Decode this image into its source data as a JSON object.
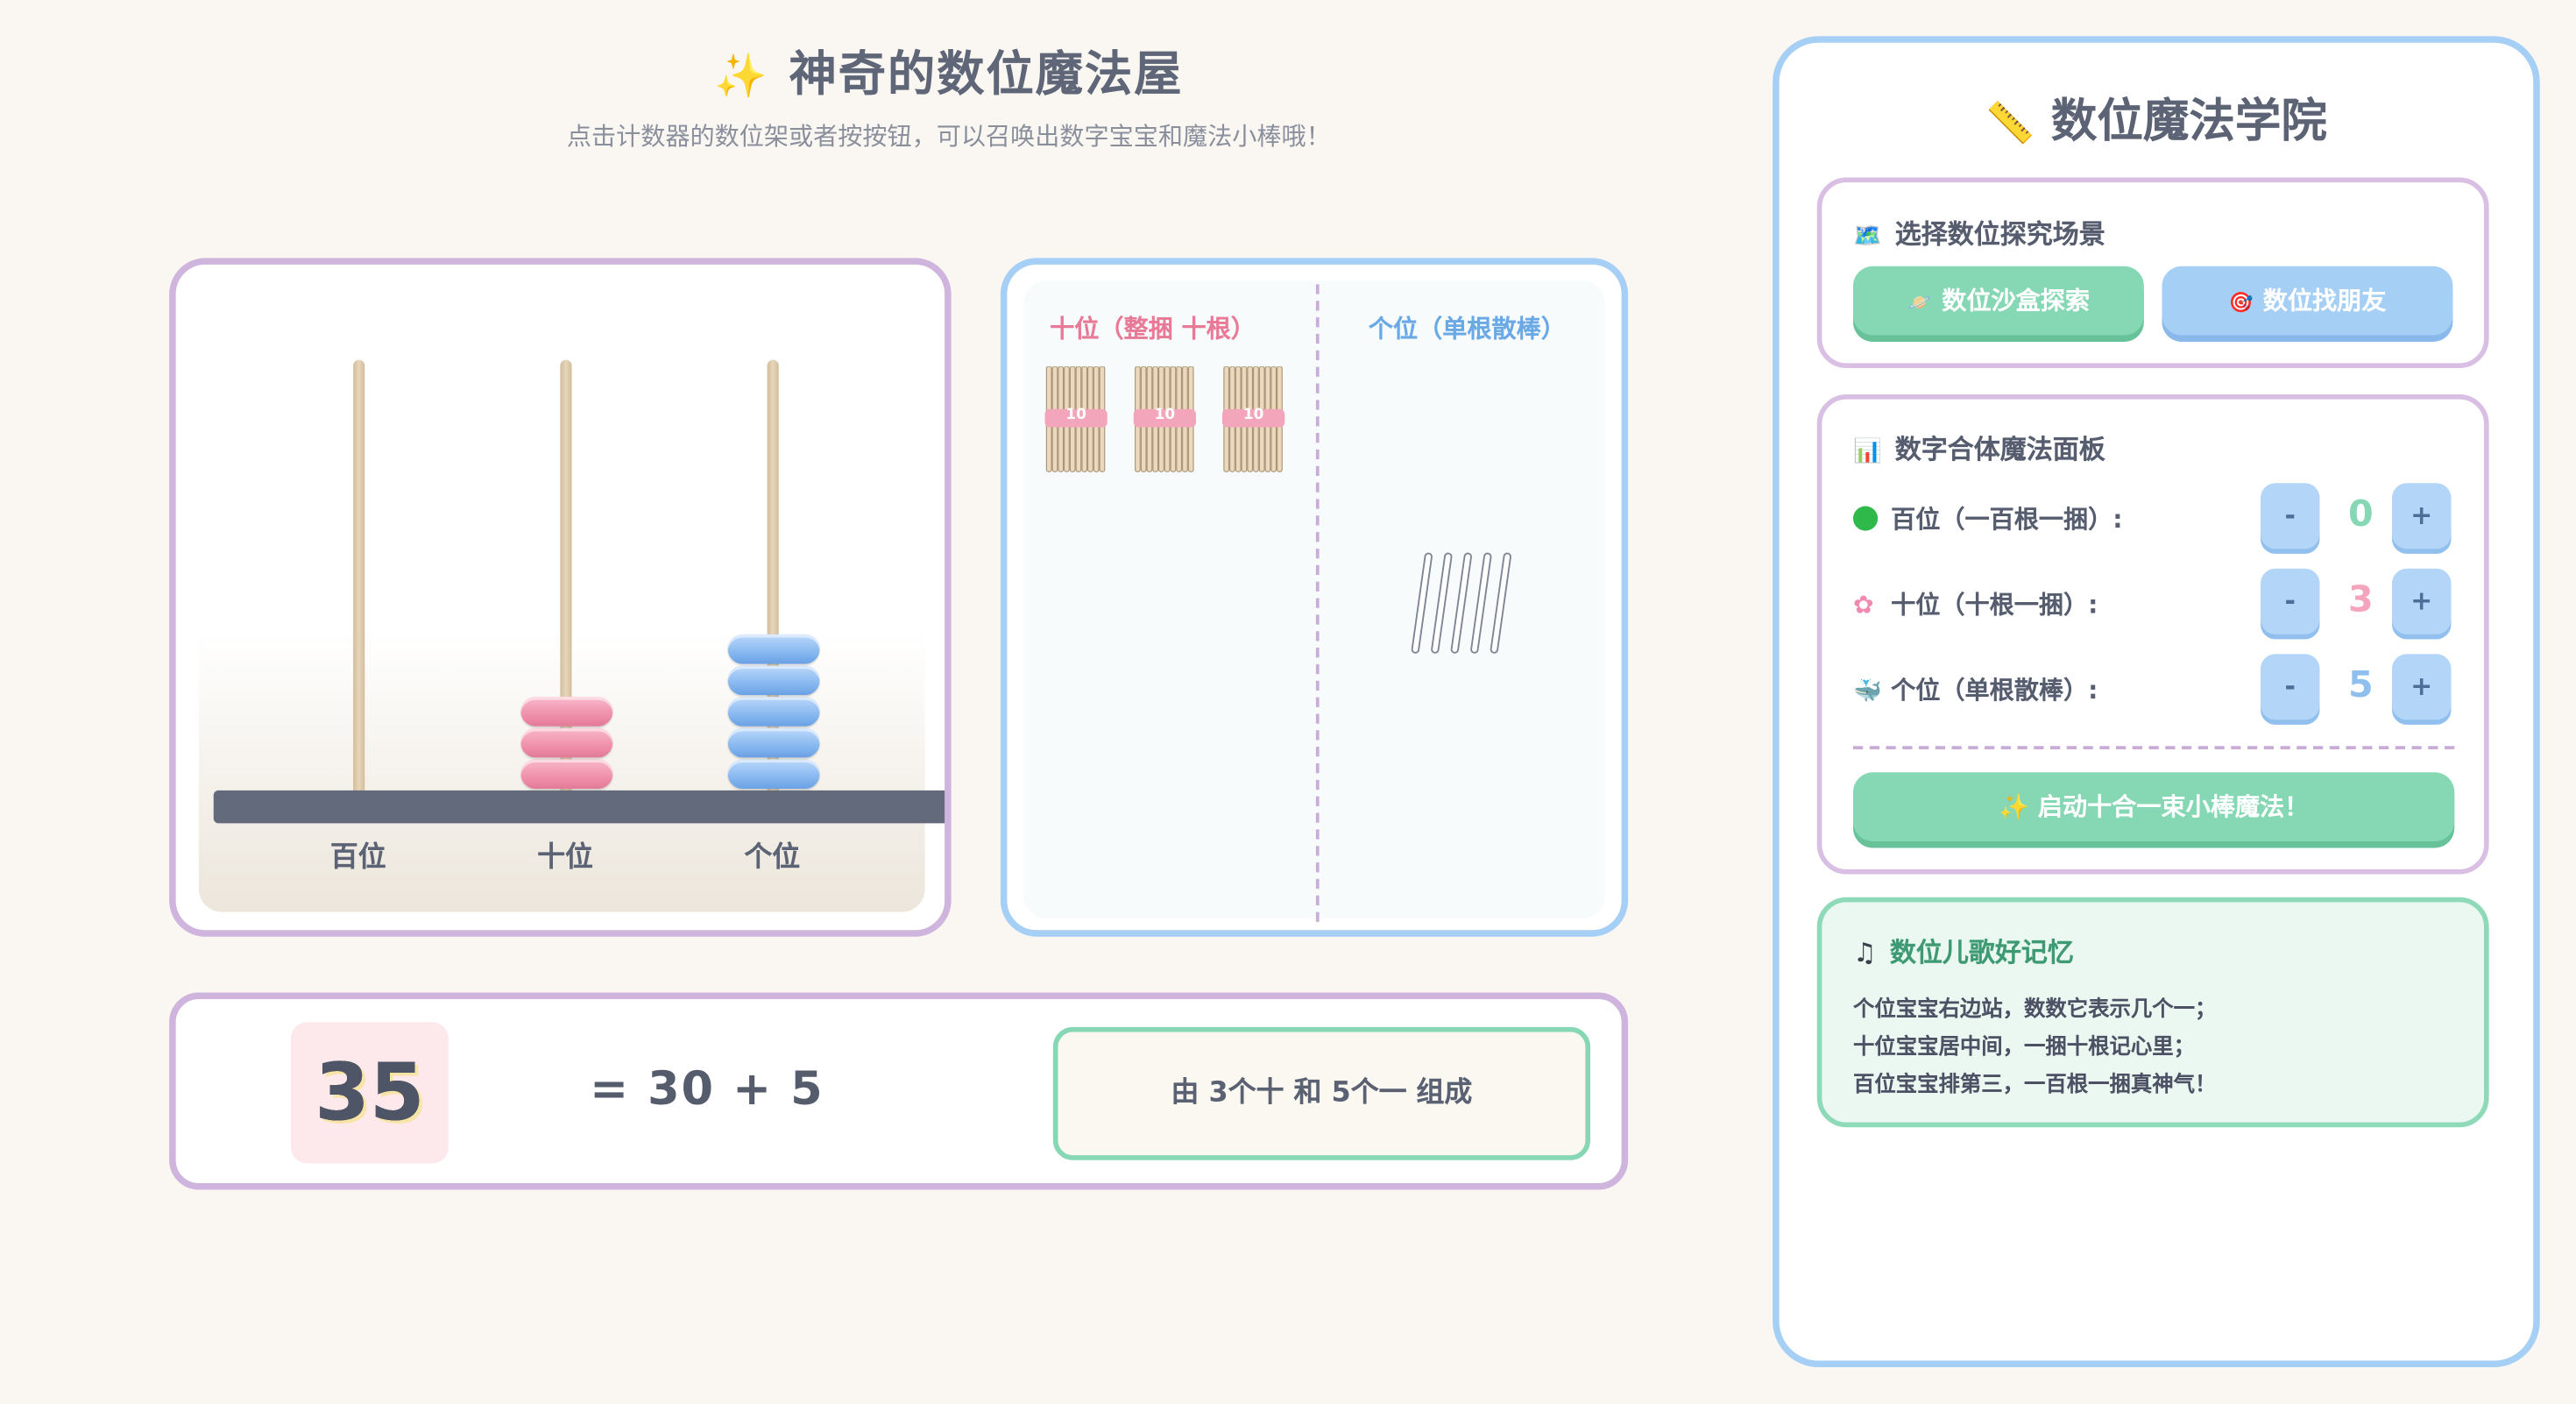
{
  "header": {
    "title": "神奇的数位魔法屋",
    "title_icon": "✨",
    "subtitle": "点击计数器的数位架或者按按钮，可以召唤出数字宝宝和魔法小棒哦！"
  },
  "abacus": {
    "rods": [
      {
        "label": "百位",
        "beads": 0,
        "color": "#ee8aa6"
      },
      {
        "label": "十位",
        "beads": 3,
        "color": "#ee8aa6"
      },
      {
        "label": "个位",
        "beads": 5,
        "color": "#80b3ee"
      }
    ]
  },
  "sticks": {
    "tens_title": "十位（整捆 十根）",
    "ones_title": "个位（单根散棒）",
    "bundle_label": "10",
    "bundle_count": 3,
    "single_count": 5
  },
  "equation": {
    "number": "35",
    "expression": "= 30 + 5",
    "composition": "由 3个十 和 5个一 组成"
  },
  "panel": {
    "title": "数位魔法学院",
    "title_icon": "📏",
    "scene": {
      "title": "选择数位探究场景",
      "icon": "🗺️",
      "buttons": [
        {
          "icon": "🪐",
          "label": "数位沙盒探索"
        },
        {
          "icon": "🎯",
          "label": "数位找朋友"
        }
      ]
    },
    "combine": {
      "title": "数字合体魔法面板",
      "icon": "📊",
      "rows": [
        {
          "icon": "green-dot",
          "label": "百位（一百根一捆）:",
          "value": "0",
          "color": "#85d8b3"
        },
        {
          "icon": "flower",
          "label": "十位（十根一捆）:",
          "value": "3",
          "color": "#f4a5bd"
        },
        {
          "icon": "whale",
          "label": "个位（单根散棒）:",
          "value": "5",
          "color": "#8fbfee"
        }
      ],
      "minus_label": "-",
      "plus_label": "+",
      "magic_button": "✨ 启动十合一束小棒魔法！"
    },
    "rhyme": {
      "title": "数位儿歌好记忆",
      "icon": "♫",
      "lines": [
        "个位宝宝右边站，数数它表示几个一；",
        "十位宝宝居中间，一捆十根记心里；",
        "百位宝宝排第三，一百根一捆真神气！"
      ]
    }
  }
}
